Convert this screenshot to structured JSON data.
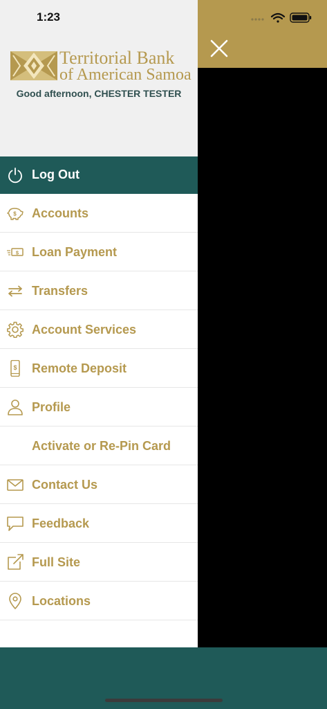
{
  "status_bar": {
    "time": "1:23"
  },
  "brand": {
    "line1": "Territorial Bank",
    "line2": "of American Samoa",
    "gold": "#b5994f",
    "teal": "#1f5a58"
  },
  "greeting": "Good afternoon, CHESTER TESTER",
  "logout": {
    "label": "Log Out",
    "icon": "power-icon"
  },
  "menu": [
    {
      "label": "Accounts",
      "icon": "piggy-bank-icon"
    },
    {
      "label": "Loan Payment",
      "icon": "cash-icon"
    },
    {
      "label": "Transfers",
      "icon": "transfer-arrows-icon"
    },
    {
      "label": "Account Services",
      "icon": "gear-icon"
    },
    {
      "label": "Remote Deposit",
      "icon": "mobile-deposit-icon"
    },
    {
      "label": "Profile",
      "icon": "person-icon"
    },
    {
      "label": "Activate or Re-Pin Card",
      "icon": ""
    },
    {
      "label": "Contact Us",
      "icon": "envelope-icon"
    },
    {
      "label": "Feedback",
      "icon": "speech-bubble-icon"
    },
    {
      "label": "Full Site",
      "icon": "external-link-icon"
    },
    {
      "label": "Locations",
      "icon": "map-pin-icon"
    }
  ]
}
